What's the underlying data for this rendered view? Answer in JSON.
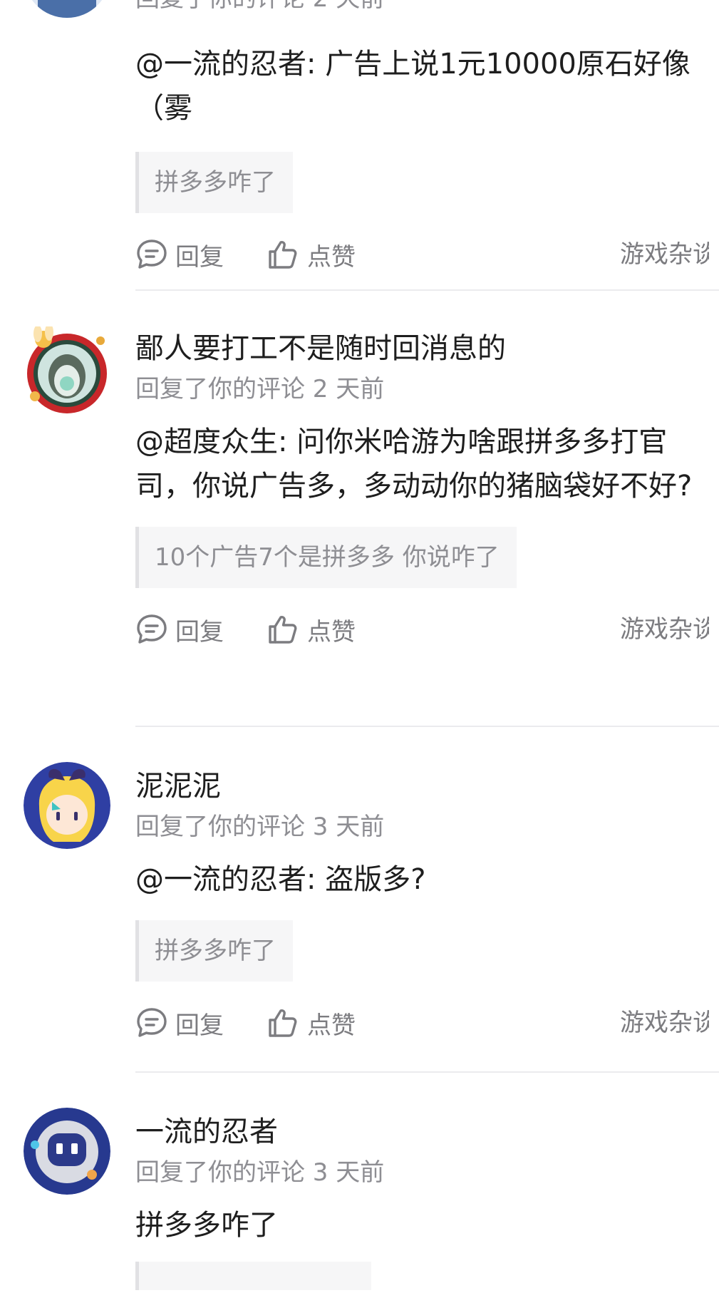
{
  "comments": [
    {
      "username": "",
      "meta": "回复了你的评论 2 天前",
      "text": "@一流的忍者: 广告上说1元10000原石好像（雾",
      "quote": "拼多多咋了",
      "reply_label": "回复",
      "like_label": "点赞",
      "tag": "游戏杂谈"
    },
    {
      "username": "鄙人要打工不是随时回消息的",
      "meta": "回复了你的评论 2 天前",
      "text": "@超度众生: 问你米哈游为啥跟拼多多打官司，你说广告多，多动动你的猪脑袋好不好?",
      "quote": "10个广告7个是拼多多 你说咋了",
      "reply_label": "回复",
      "like_label": "点赞",
      "tag": "游戏杂谈"
    },
    {
      "username": "泥泥泥",
      "meta": "回复了你的评论 3 天前",
      "text": "@一流的忍者: 盗版多?",
      "quote": "拼多多咋了",
      "reply_label": "回复",
      "like_label": "点赞",
      "tag": "游戏杂谈"
    },
    {
      "username": "一流的忍者",
      "meta": "回复了你的评论 3 天前",
      "text": "拼多多咋了",
      "quote": "",
      "reply_label": "",
      "like_label": "",
      "tag": ""
    }
  ],
  "colors": {
    "text": "#1e1e1e",
    "secondary": "#8e8e93",
    "quote_bg": "#f6f6f7",
    "divider": "#ebebee"
  },
  "icons": {
    "reply": "comment-bubble-icon",
    "like": "thumbs-up-icon"
  }
}
